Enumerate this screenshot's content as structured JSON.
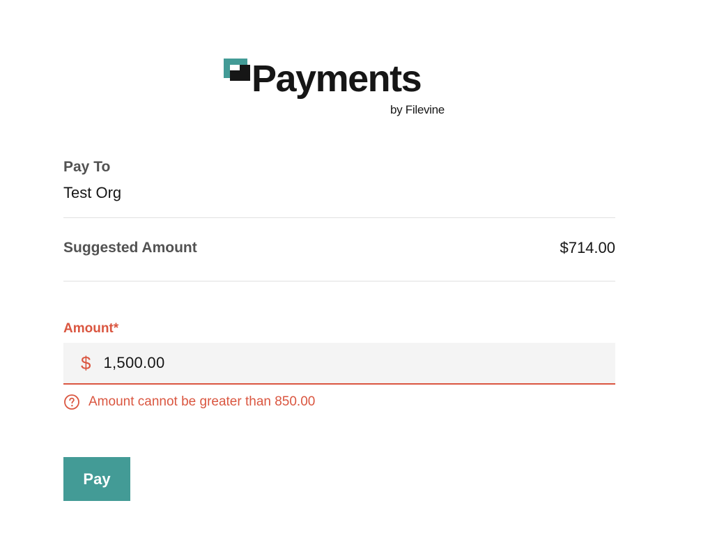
{
  "brand": {
    "name": "Payments",
    "subtitle": "by Filevine",
    "logo_icon": "filevine-logo-icon",
    "colors": {
      "teal": "#439b96",
      "dark": "#161616"
    }
  },
  "pay_to": {
    "label": "Pay To",
    "value": "Test Org"
  },
  "suggested": {
    "label": "Suggested Amount",
    "value": "$714.00"
  },
  "amount": {
    "label": "Amount*",
    "currency_symbol": "$",
    "value": "1,500.00",
    "error_icon": "help-circle-icon",
    "error": "Amount cannot be greater than 850.00"
  },
  "actions": {
    "pay_label": "Pay"
  },
  "colors": {
    "error": "#da5640",
    "input_bg": "#f4f4f4",
    "divider": "#e0e0e0",
    "muted_label": "#525252"
  }
}
